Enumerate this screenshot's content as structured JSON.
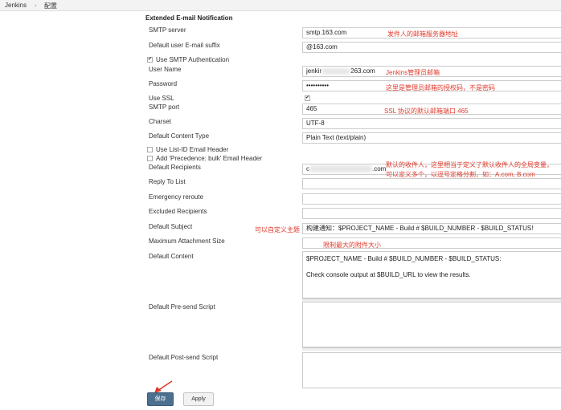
{
  "breadcrumb": {
    "root": "Jenkins",
    "separator": "›",
    "current": "配置"
  },
  "section": {
    "title": "Extended E-mail Notification"
  },
  "labels": {
    "smtp_server": "SMTP server",
    "email_suffix": "Default user E-mail suffix",
    "use_smtp_auth": "Use SMTP Authentication",
    "user_name": "User Name",
    "password": "Password",
    "use_ssl": "Use SSL",
    "smtp_port": "SMTP port",
    "charset": "Charset",
    "content_type": "Default Content Type",
    "list_id_header": "Use List-ID Email Header",
    "precedence_header": "Add 'Precedence: bulk' Email Header",
    "recipients": "Default Recipients",
    "reply_to": "Reply To List",
    "emergency": "Emergency reroute",
    "excluded": "Excluded Recipients",
    "subject": "Default Subject",
    "max_attach": "Maximum Attachment Size",
    "content": "Default Content",
    "presend": "Default Pre-send Script",
    "postsend": "Default Post-send Script"
  },
  "values": {
    "smtp_server": "smtp.163.com",
    "email_suffix": "@163.com",
    "user_name_prefix": "jenkir",
    "user_name_suffix": "263.com",
    "password": "••••••••••",
    "smtp_port": "465",
    "charset": "UTF-8",
    "content_type": "Plain Text (text/plain)",
    "recipients_prefix": "c",
    "recipients_suffix": ".com",
    "subject": "构建通知：$PROJECT_NAME - Build # $BUILD_NUMBER - $BUILD_STATUS!",
    "content": "$PROJECT_NAME - Build # $BUILD_NUMBER - $BUILD_STATUS:\n\nCheck console output at $BUILD_URL to view the results."
  },
  "checks": {
    "use_smtp_auth": "✔",
    "use_ssl": "✔"
  },
  "annotations": {
    "smtp_server": "发件人的邮箱服务器地址",
    "user_name": "Jenkins管理员邮箱",
    "password": "这里是管理员邮箱的授权码，不是密码",
    "smtp_port": "SSL 协议的默认邮箱端口 465",
    "recipients_line1": "默认的收件人，这里相当于定义了默认收件人的全局变量，",
    "recipients_line2": "可以定义多个，以逗号定格分割，如：A.com, B.com",
    "subject": "可以自定义主题",
    "max_attach": "限制最大的附件大小"
  },
  "buttons": {
    "save": "保存",
    "apply": "Apply"
  },
  "colors": {
    "annotation": "#e0392b",
    "save_button": "#4b6f8f"
  }
}
